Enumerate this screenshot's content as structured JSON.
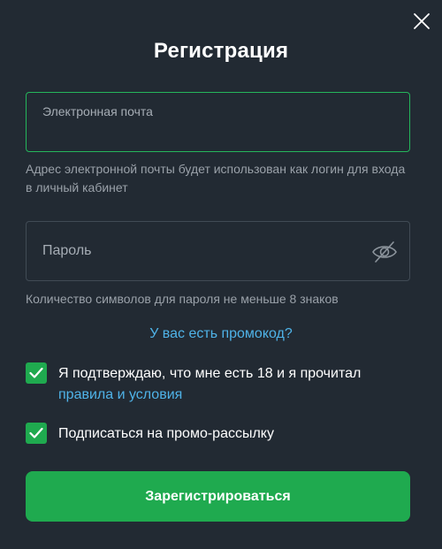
{
  "modal": {
    "title": "Регистрация",
    "close_icon": "close-icon"
  },
  "email": {
    "label": "Электронная почта",
    "value": "",
    "hint": "Адрес электронной почты будет использован как логин для входа в личный кабинет"
  },
  "password": {
    "placeholder": "Пароль",
    "value": "",
    "visibility_icon": "eye-off-icon",
    "hint": "Количество символов для пароля не меньше 8 знаков"
  },
  "promo": {
    "link_label": "У вас есть промокод?"
  },
  "agreements": {
    "age_text": "Я подтверждаю, что мне есть 18 и я прочитал",
    "terms_link": "правила и условия",
    "age_checked": true,
    "newsletter_text": "Подписаться на промо-рассылку",
    "newsletter_checked": true
  },
  "actions": {
    "register_label": "Зарегистрироваться"
  },
  "colors": {
    "background": "#222a33",
    "accent": "#1faa4f",
    "link": "#4fb3e8",
    "focus_border": "#25b55b"
  }
}
